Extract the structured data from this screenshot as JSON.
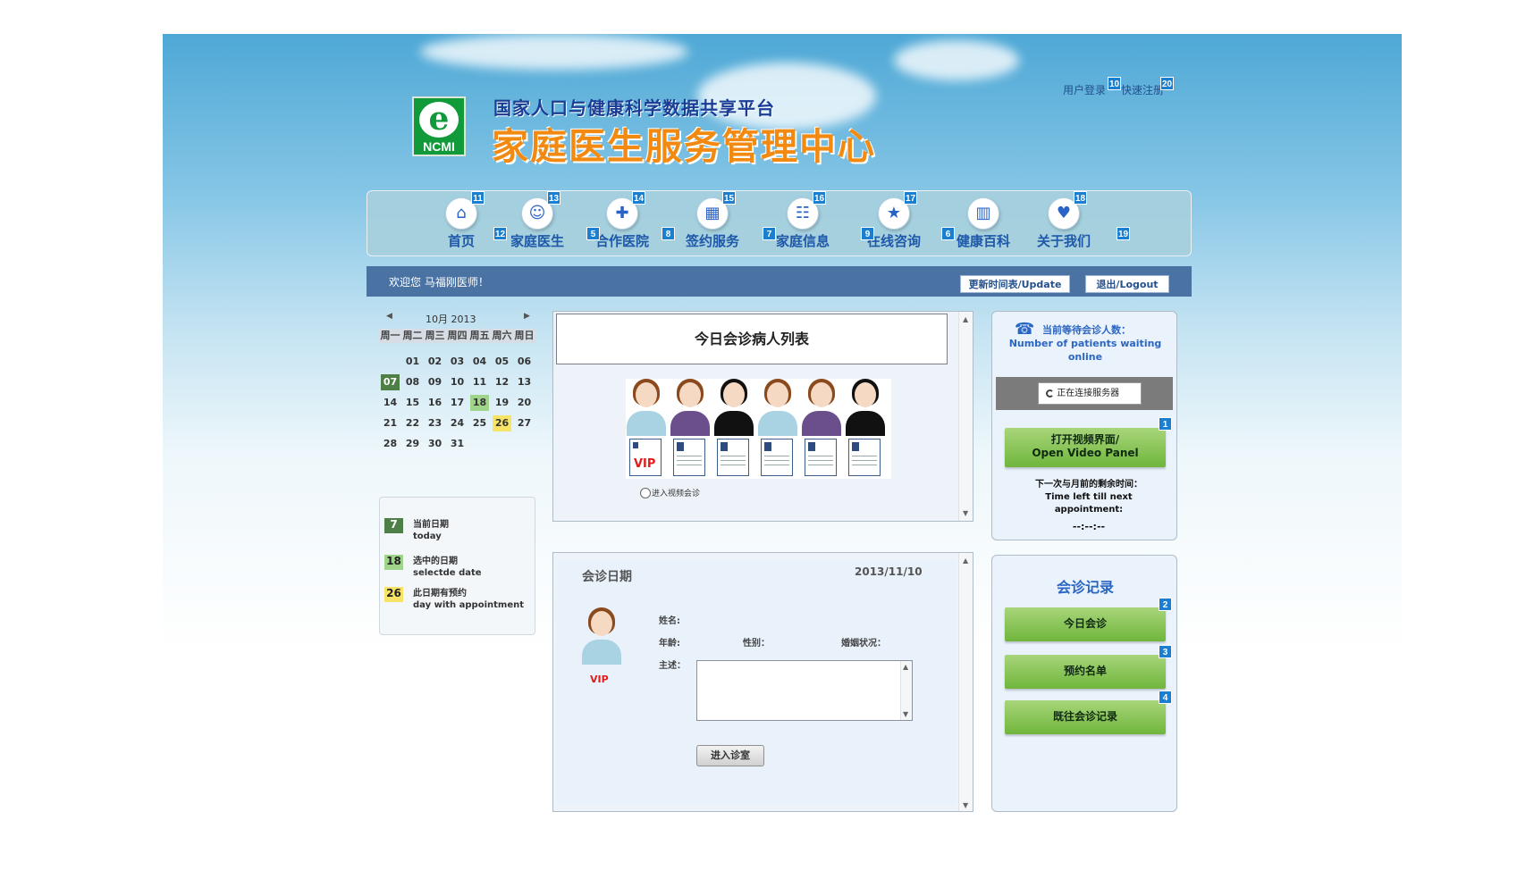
{
  "header": {
    "logo_text": "NCMI",
    "subtitle": "国家人口与健康科学数据共享平台",
    "title": "家庭医生服务管理中心",
    "login_link": "用户登录",
    "register_link": "快速注册",
    "badges": {
      "login": "10",
      "register": "20"
    }
  },
  "nav": {
    "items": [
      {
        "label": "首页",
        "icon": "home-icon",
        "glyph": "⌂",
        "badge": "11"
      },
      {
        "label": "家庭医生",
        "icon": "doctor-icon",
        "glyph": "☺",
        "badge": "13"
      },
      {
        "label": "合作医院",
        "icon": "hospital-icon",
        "glyph": "✚",
        "badge": "14"
      },
      {
        "label": "签约服务",
        "icon": "calendar-icon",
        "glyph": "▦",
        "badge": "15"
      },
      {
        "label": "家庭信息",
        "icon": "family-info-icon",
        "glyph": "☷",
        "badge": "16"
      },
      {
        "label": "在线咨询",
        "icon": "consult-icon",
        "glyph": "★",
        "badge": "17"
      },
      {
        "label": "健康百科",
        "icon": "book-icon",
        "glyph": "▥",
        "badge": ""
      },
      {
        "label": "关于我们",
        "icon": "handshake-icon",
        "glyph": "♥",
        "badge": "18"
      }
    ],
    "between_badges": [
      "12",
      "5",
      "8",
      "7",
      "9",
      "6",
      "19"
    ]
  },
  "welcome": {
    "text": "欢迎您   马福刚医师！",
    "update_button": "更新时间表/Update",
    "logout_button": "退出/Logout"
  },
  "calendar": {
    "month_label": "10月  2013",
    "prev": "◀",
    "next": "▶",
    "weekdays": [
      "周一",
      "周二",
      "周三",
      "周四",
      "周五",
      "周六",
      "周日"
    ],
    "weeks": [
      [
        "",
        "01",
        "02",
        "03",
        "04",
        "05",
        "06"
      ],
      [
        "07",
        "08",
        "09",
        "10",
        "11",
        "12",
        "13"
      ],
      [
        "14",
        "15",
        "16",
        "17",
        "18",
        "19",
        "20"
      ],
      [
        "21",
        "22",
        "23",
        "24",
        "25",
        "26",
        "27"
      ],
      [
        "28",
        "29",
        "30",
        "31",
        "",
        "",
        ""
      ]
    ],
    "today": "07",
    "selected": "18",
    "appointment": "26"
  },
  "legend": [
    {
      "num": "7",
      "cn": "当前日期",
      "en": "today",
      "bg": "#4e7f46",
      "fg": "#ffffff"
    },
    {
      "num": "18",
      "cn": "选中的日期",
      "en": "selectde date",
      "bg": "#9ed58a",
      "fg": "#222222"
    },
    {
      "num": "26",
      "cn": "此日期有预约",
      "en": "day with appointment",
      "bg": "#f7e466",
      "fg": "#222222"
    }
  ],
  "patient_list": {
    "title": "今日会诊病人列表",
    "vip_label": "VIP",
    "radio_label": "进入视频会诊"
  },
  "consult": {
    "date_label": "会诊日期",
    "date_value": "2013/11/10",
    "vip_label": "VIP",
    "name_label": "姓名:",
    "age_label": "年龄:",
    "gender_label": "性别：",
    "marital_label": "婚姻状况：",
    "complaint_label": "主述：",
    "enter_button": "进入诊室"
  },
  "waiting": {
    "title_cn": "当前等待会诊人数：",
    "title_en": "Number of patients waiting online",
    "connecting": "正在连接服务器",
    "video_button_cn": "打开视频界面/",
    "video_button_en": "Open Video Panel",
    "video_badge": "1",
    "time_label_cn": "下一次与月前的剩余时间：",
    "time_label_en": "Time left till next appointment:",
    "time_value": "--:--:--"
  },
  "records": {
    "title": "会诊记录",
    "buttons": [
      {
        "label": "今日会诊",
        "badge": "2"
      },
      {
        "label": "预约名单",
        "badge": "3"
      },
      {
        "label": "既往会诊记录",
        "badge": "4"
      }
    ]
  }
}
